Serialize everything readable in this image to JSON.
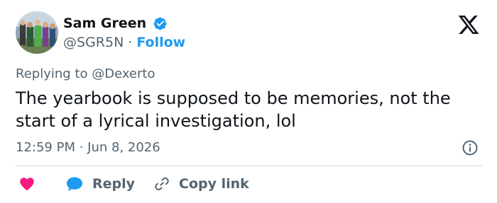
{
  "author": {
    "name": "Sam Green",
    "handle": "@SGR5N",
    "separator": "·",
    "follow_label": "Follow",
    "verified_color": "#1d9bf0"
  },
  "reply_context": {
    "prefix": "Replying to",
    "mention": "@Dexerto"
  },
  "tweet": {
    "text": "The yearbook is supposed to be memories, not the start of a lyrical investigation, lol",
    "timestamp": "12:59 PM · Jun 8, 2026"
  },
  "actions": {
    "like_icon": "heart-icon",
    "reply_label": "Reply",
    "copy_link_label": "Copy link"
  },
  "colors": {
    "accent": "#1d9bf0",
    "like": "#f91880",
    "text": "#0f1419",
    "muted": "#536471",
    "divider": "#cfd9de"
  },
  "icons": [
    "x-logo-icon",
    "verified-badge-icon",
    "info-icon",
    "heart-icon",
    "reply-bubble-icon",
    "link-icon"
  ]
}
